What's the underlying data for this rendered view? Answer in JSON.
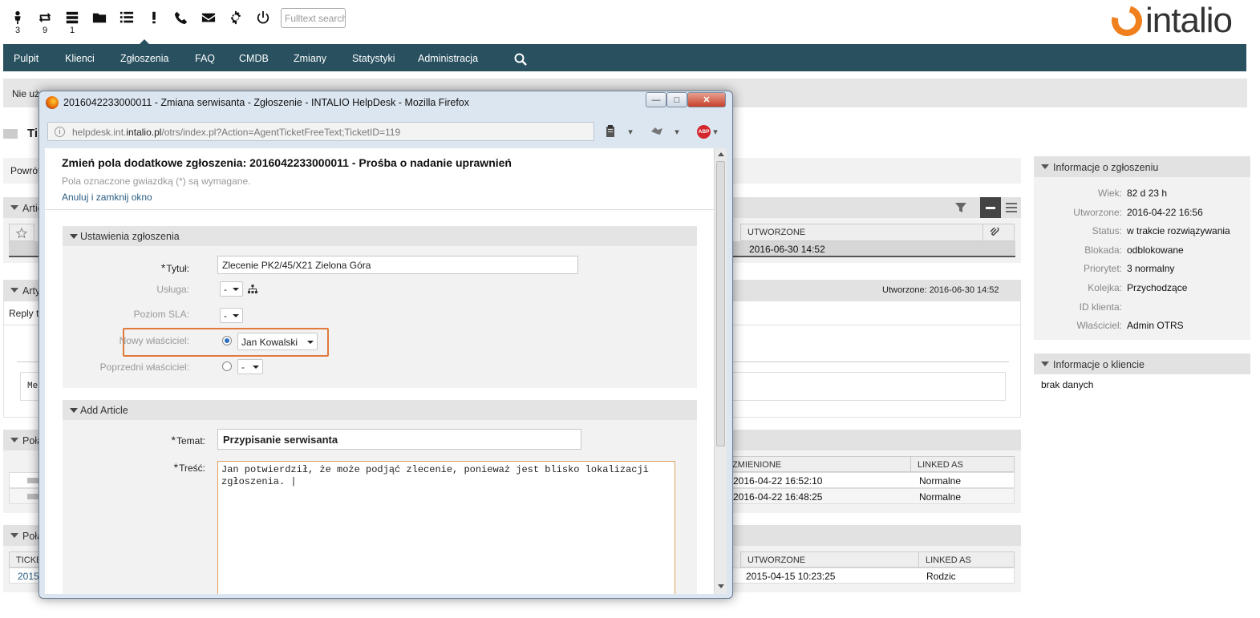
{
  "topbar": {
    "icons": [
      {
        "name": "locked-tickets-icon",
        "count": "3"
      },
      {
        "name": "watched-tickets-icon",
        "count": "9"
      },
      {
        "name": "responsible-tickets-icon",
        "count": "1"
      },
      {
        "name": "folder-icon",
        "count": ""
      },
      {
        "name": "queue-view-icon",
        "count": ""
      },
      {
        "name": "escalation-icon",
        "count": ""
      },
      {
        "name": "phone-icon",
        "count": ""
      },
      {
        "name": "email-icon",
        "count": ""
      },
      {
        "name": "gear-icon",
        "count": ""
      },
      {
        "name": "power-icon",
        "count": ""
      }
    ],
    "search_placeholder": "Fulltext search",
    "logo_text": "intalio"
  },
  "nav": {
    "items": [
      "Pulpit",
      "Klienci",
      "Zgłoszenia",
      "FAQ",
      "CMDB",
      "Zmiany",
      "Statystyki",
      "Administracja"
    ],
    "active": "Zgłoszenia"
  },
  "background": {
    "notice": "Nie uż",
    "title_fragment": "Ti",
    "back_fragment": "Powrót",
    "articles_fragment": "Artic",
    "article_fragment": "Arty",
    "reply_fragment": "Reply to",
    "me_fragment": "Me",
    "linked1_fragment": "Poła",
    "linked2_fragment": "Poła",
    "ticket_fragment": "TICKE",
    "ticket_num_fragment": "2015",
    "article_table": {
      "header_created": "UTWORZONE",
      "row_created": "2016-06-30 14:52"
    },
    "article_created_label": "Utworzone: 2016-06-30 14:52",
    "linked_table": {
      "col_changed": "ZMIENIONE",
      "col_linked": "LINKED AS",
      "rows": [
        {
          "changed": "2016-04-22 16:52:10",
          "linked": "Normalne"
        },
        {
          "changed": "2016-04-22 16:48:25",
          "linked": "Normalne"
        }
      ]
    },
    "linked_table2": {
      "col_created": "UTWORZONE",
      "col_linked": "LINKED AS",
      "rows": [
        {
          "created": "2015-04-15 10:23:25",
          "linked": "Rodzic"
        }
      ]
    }
  },
  "ticket_info": {
    "title": "Informacje o zgłoszeniu",
    "rows": [
      {
        "label": "Wiek:",
        "value": "82 d 23 h"
      },
      {
        "label": "Utworzone:",
        "value": "2016-04-22 16:56"
      },
      {
        "label": "Status:",
        "value": "w trakcie rozwiązywania"
      },
      {
        "label": "Blokada:",
        "value": "odblokowane"
      },
      {
        "label": "Priorytet:",
        "value": "3 normalny"
      },
      {
        "label": "Kolejka:",
        "value": "Przychodzące"
      },
      {
        "label": "ID klienta:",
        "value": ""
      },
      {
        "label": "Właściciel:",
        "value": "Admin OTRS"
      }
    ]
  },
  "customer_info": {
    "title": "Informacje o kliencie",
    "value": "brak danych"
  },
  "popup": {
    "window_title": "2016042233000011 - Zmiana serwisanta - Zgłoszenie - INTALIO HelpDesk - Mozilla Firefox",
    "url_prefix": "helpdesk.int.",
    "url_domain": "intalio.pl",
    "url_rest": "/otrs/index.pl?Action=AgentTicketFreeText;TicketID=119",
    "heading": "Zmień pola dodatkowe zgłoszenia: 2016042233000011 - Prośba o nadanie uprawnień",
    "required_hint": "Pola oznaczone gwiazdką (*) są wymagane.",
    "cancel_link": "Anuluj i zamknij okno",
    "settings_section": "Ustawienia zgłoszenia",
    "fields": {
      "title_label": "Tytuł:",
      "title_value": "Zlecenie PK2/45/X21 Zielona Góra",
      "service_label": "Usługa:",
      "service_value": "-",
      "sla_label": "Poziom SLA:",
      "sla_value": "-",
      "new_owner_label": "Nowy właściciel:",
      "new_owner_value": "Jan Kowalski",
      "prev_owner_label": "Poprzedni właściciel:",
      "prev_owner_value": "-"
    },
    "article_section": "Add Article",
    "subject_label": "Temat:",
    "subject_value": "Przypisanie serwisanta",
    "body_label": "Treść:",
    "body_value": "Jan potwierdził, że może podjąć zlecenie, ponieważ jest blisko lokalizacji\nzgłoszenia. |"
  }
}
